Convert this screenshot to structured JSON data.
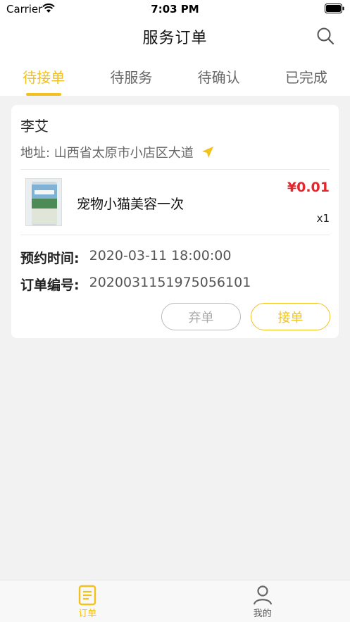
{
  "status_bar": {
    "carrier": "Carrier",
    "time": "7:03 PM"
  },
  "header": {
    "title": "服务订单",
    "search_icon": "search-icon"
  },
  "tabs": [
    {
      "label": "待接单",
      "active": true
    },
    {
      "label": "待服务",
      "active": false
    },
    {
      "label": "待确认",
      "active": false
    },
    {
      "label": "已完成",
      "active": false
    }
  ],
  "order": {
    "customer_name": "李艾",
    "address": "地址: 山西省太原市小店区大道",
    "product": {
      "name": "宠物小猫美容一次",
      "price": "¥0.01",
      "quantity": "x1"
    },
    "appointment_label": "预约时间:",
    "appointment_time": "2020-03-11 18:00:00",
    "order_no_label": "订单编号:",
    "order_no": "2020031151975056101",
    "abandon_label": "弃单",
    "accept_label": "接单"
  },
  "bottom_nav": [
    {
      "label": "订单",
      "icon": "order-list-icon",
      "active": true
    },
    {
      "label": "我的",
      "icon": "profile-icon",
      "active": false
    }
  ],
  "colors": {
    "accent": "#f3c11c",
    "price": "#e5262b",
    "background": "#f2f2f2"
  }
}
